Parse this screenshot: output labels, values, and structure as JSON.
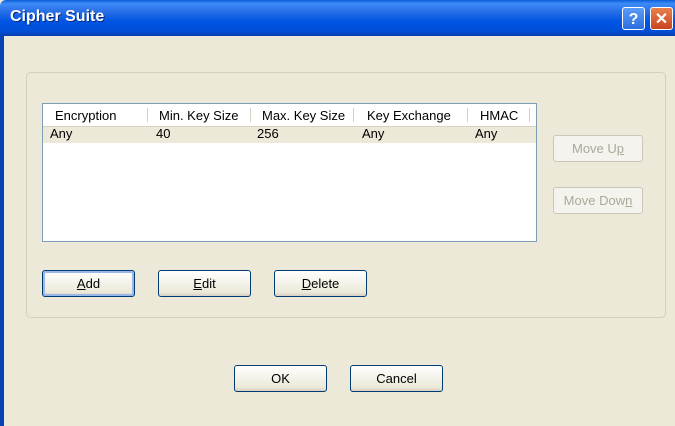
{
  "window": {
    "title": "Cipher Suite",
    "help_icon": "?",
    "close_icon": "✕"
  },
  "table": {
    "columns": [
      "Encryption",
      "Min. Key Size",
      "Max. Key Size",
      "Key Exchange",
      "HMAC"
    ],
    "rows": [
      [
        "Any",
        "40",
        "256",
        "Any",
        "Any"
      ]
    ]
  },
  "side_buttons": {
    "move_up": {
      "pre": "Move U",
      "key": "p",
      "post": ""
    },
    "move_down": {
      "pre": "Move Dow",
      "key": "n",
      "post": ""
    }
  },
  "action_buttons": {
    "add": {
      "pre": "",
      "key": "A",
      "post": "dd"
    },
    "edit": {
      "pre": "",
      "key": "E",
      "post": "dit"
    },
    "delete": {
      "pre": "",
      "key": "D",
      "post": "elete"
    }
  },
  "footer": {
    "ok": "OK",
    "cancel": "Cancel"
  }
}
